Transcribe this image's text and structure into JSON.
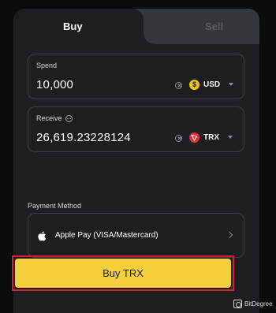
{
  "tabs": {
    "buy_label": "Buy",
    "sell_label": "Sell",
    "active": "Buy"
  },
  "spend": {
    "label": "Spend",
    "value": "10,000",
    "currency": "USD",
    "coin_symbol": "$",
    "coin_icon": "usd-coin-icon"
  },
  "receive": {
    "label": "Receive",
    "value": "26,619.23228124",
    "currency": "TRX",
    "coin_icon": "trx-coin-icon"
  },
  "payment": {
    "label": "Payment Method",
    "method": "Apple Pay (VISA/Mastercard)",
    "icon": "apple-icon"
  },
  "action": {
    "buy_button_label": "Buy TRX"
  },
  "watermark": {
    "text": "BitDegree"
  },
  "colors": {
    "background": "#0c0c0d",
    "card": "#1d1e21",
    "inactive_tab": "#34373c",
    "accent_button": "#f5cf3a",
    "highlight_box": "#d81e28",
    "usd_coin": "#f0c419",
    "trx_coin": "#e32b34"
  }
}
